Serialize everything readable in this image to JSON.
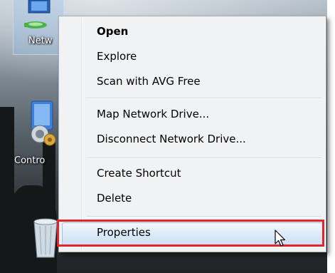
{
  "desktop": {
    "icons": [
      {
        "label": "Netw",
        "icon": "network-icon"
      },
      {
        "label": "Contro",
        "icon": "control-panel-icon"
      },
      {
        "label": "",
        "icon": "recycle-bin-icon"
      }
    ]
  },
  "context_menu": {
    "items": [
      {
        "label": "Open",
        "bold": true
      },
      {
        "label": "Explore"
      },
      {
        "label": "Scan with AVG Free"
      },
      {
        "label": "Map Network Drive..."
      },
      {
        "label": "Disconnect Network Drive..."
      },
      {
        "label": "Create Shortcut"
      },
      {
        "label": "Delete"
      },
      {
        "label": "Properties",
        "highlighted": true
      }
    ]
  },
  "colors": {
    "highlight_border": "#e0262a",
    "hover_fill": "#dceaf9"
  }
}
